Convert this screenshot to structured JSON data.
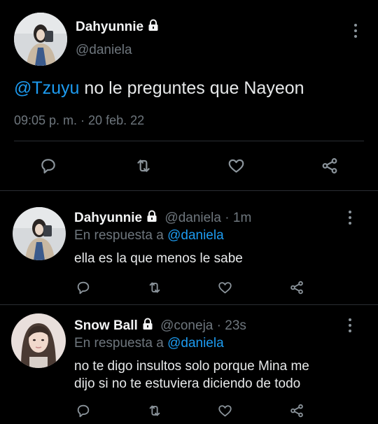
{
  "main_tweet": {
    "display_name": "Dahyunnie",
    "handle": "@daniela",
    "mention": "@Tzuyu",
    "text": " no le preguntes que Nayeon",
    "timestamp": "09:05 p. m. · 20 feb. 22",
    "avatar_icon": "user-avatar-photo",
    "lock_icon": "lock-icon"
  },
  "replies": [
    {
      "display_name": "Dahyunnie",
      "handle": "@daniela",
      "time": "· 1m",
      "reply_prefix": "En respuesta a",
      "reply_to": "@daniela",
      "text_lines": [
        "ella es la que menos le sabe"
      ]
    },
    {
      "display_name": "Snow Ball",
      "handle": "@coneja",
      "time": "· 23s",
      "reply_prefix": "En respuesta a",
      "reply_to": "@daniela",
      "text_lines": [
        "no te digo insultos solo porque Mina me",
        "dijo si no te estuviera diciendo de todo"
      ]
    }
  ],
  "colors": {
    "background": "#000000",
    "link": "#1d9bf0",
    "muted": "#6e767d",
    "icon": "#8b949b",
    "divider": "#2a2e33"
  },
  "action_icons": [
    "reply-icon",
    "retweet-icon",
    "like-icon",
    "share-icon"
  ]
}
